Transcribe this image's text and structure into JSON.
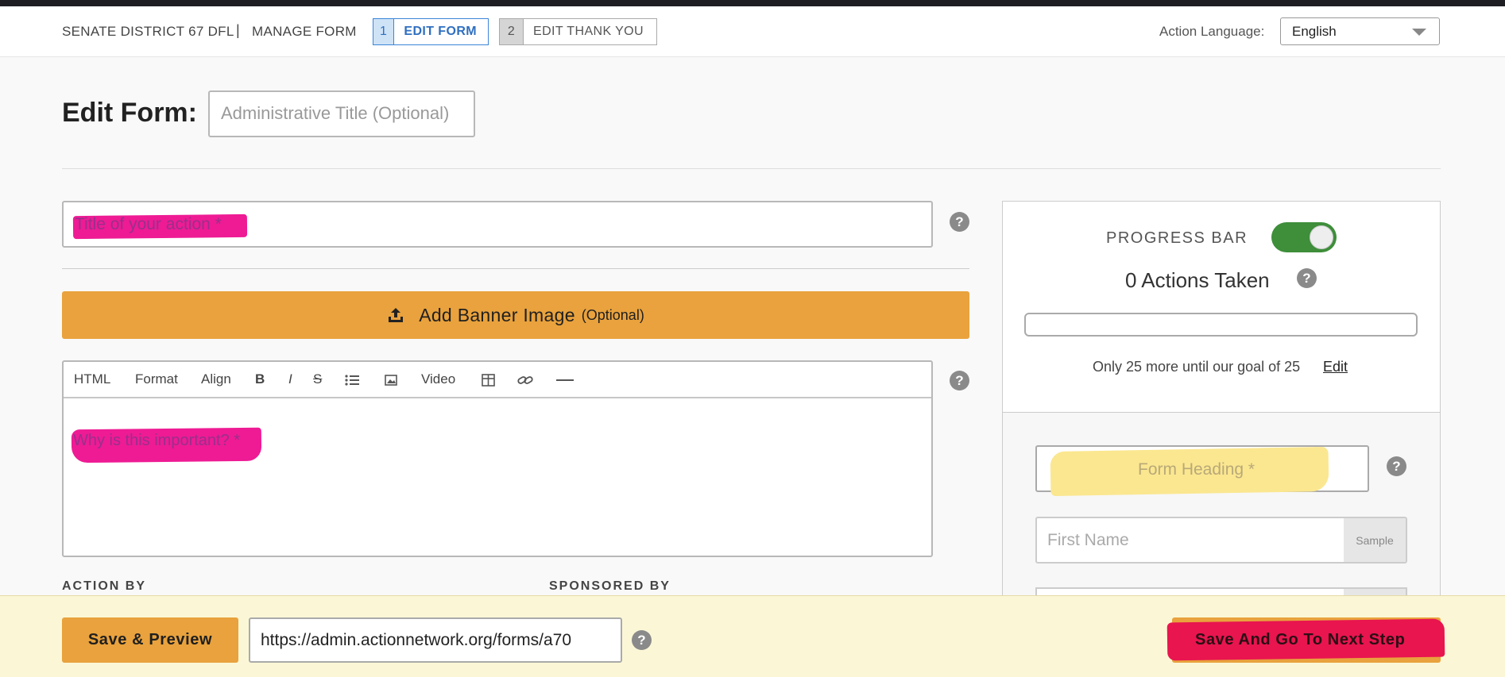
{
  "header": {
    "org_name": "SENATE DISTRICT 67 DFL",
    "separator": "|",
    "manage_form": "MANAGE FORM",
    "steps": [
      {
        "num": "1",
        "label": "EDIT FORM",
        "active": true
      },
      {
        "num": "2",
        "label": "EDIT THANK YOU",
        "active": false
      }
    ],
    "language_label": "Action Language:",
    "language_value": "English"
  },
  "page": {
    "title": "Edit Form:",
    "admin_title_placeholder": "Administrative Title (Optional)"
  },
  "form": {
    "action_title_placeholder": "Title of your action *",
    "banner_button_label": "Add Banner Image",
    "banner_button_optional": "(Optional)",
    "editor_toolbar": [
      "HTML",
      "Format",
      "Align",
      "B",
      "I",
      "S",
      "Video"
    ],
    "editor_toolbar_icons": [
      "list-icon",
      "image-icon",
      "table-icon",
      "link-icon",
      "horizontal-rule-icon"
    ],
    "description_placeholder": "Why is this important? *",
    "action_by_label": "ACTION BY",
    "sponsored_by_label": "SPONSORED BY"
  },
  "sidebar": {
    "progress_bar_label": "PROGRESS BAR",
    "progress_bar_enabled": true,
    "actions_taken": "0 Actions Taken",
    "progress_fraction": 0,
    "goal_text": "Only 25 more until our goal of 25",
    "goal_edit_link": "Edit",
    "form_heading_placeholder": "Form Heading *",
    "first_name_placeholder": "First Name",
    "sample_label": "Sample"
  },
  "footer": {
    "save_preview_label": "Save & Preview",
    "form_url": "https://admin.actionnetwork.org/forms/a70",
    "save_next_label": "Save And Go To Next Step"
  },
  "colors": {
    "accent_orange": "#e9a23d",
    "active_blue": "#2f6fc0",
    "toggle_green": "#3e8e3a",
    "pink_highlight": "#ee1b94",
    "yellow_highlight": "#fbe790",
    "footer_bg": "#fbf7d6"
  }
}
